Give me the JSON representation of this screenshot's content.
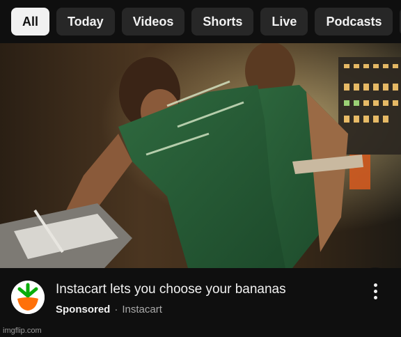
{
  "chips": [
    {
      "label": "All"
    },
    {
      "label": "Today"
    },
    {
      "label": "Videos"
    },
    {
      "label": "Shorts"
    },
    {
      "label": "Live"
    },
    {
      "label": "Podcasts"
    }
  ],
  "chips_active_index": 0,
  "video": {
    "share_icon": "arrow-up-right-icon"
  },
  "ad": {
    "title": "Instacart lets you choose your bananas",
    "sponsored_label": "Sponsored",
    "separator": "·",
    "advertiser": "Instacart",
    "avatar_icon": "instacart-carrot-logo",
    "more_icon": "more-vertical-icon",
    "brand_colors": {
      "leaf": "#0aad0a",
      "carrot": "#ff7009"
    }
  },
  "watermark": "imgflip.com",
  "colors": {
    "background": "#0f0f0f",
    "chip_bg": "#272727",
    "chip_active_bg": "#f1f1f1",
    "text_primary": "#f1f1f1",
    "text_secondary": "#aaaaaa"
  }
}
